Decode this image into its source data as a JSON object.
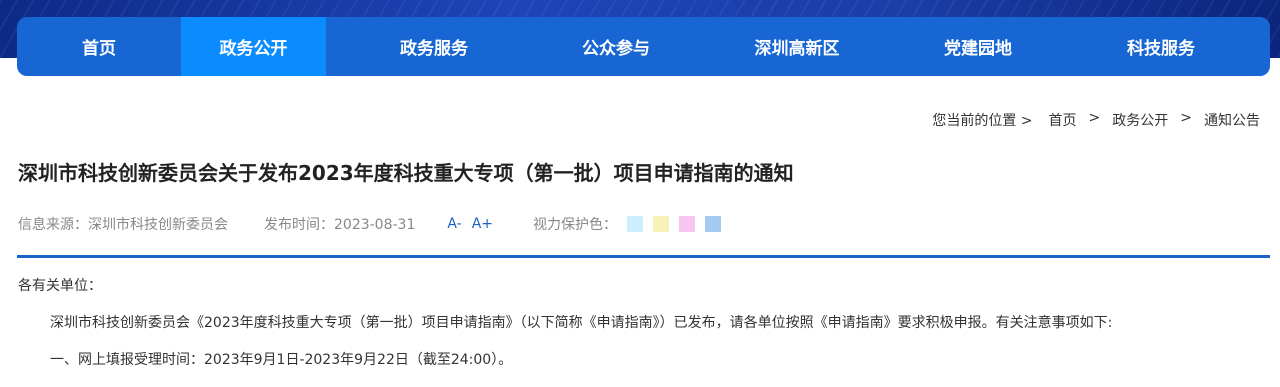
{
  "nav": {
    "items": [
      {
        "label": "首页"
      },
      {
        "label": "政务公开"
      },
      {
        "label": "政务服务"
      },
      {
        "label": "公众参与"
      },
      {
        "label": "深圳高新区"
      },
      {
        "label": "党建园地"
      },
      {
        "label": "科技服务"
      }
    ],
    "active_index": 1
  },
  "breadcrumb": {
    "prefix": "您当前的位置 >",
    "items": [
      "首页",
      "政务公开",
      "通知公告"
    ],
    "separator": ">"
  },
  "article": {
    "title": "深圳市科技创新委员会关于发布2023年度科技重大专项（第一批）项目申请指南的通知",
    "source": "信息来源：深圳市科技创新委员会",
    "publish_time": "发布时间：2023-08-31",
    "font_decrease": "A-",
    "font_increase": "A+",
    "eye_protect_label": "视力保护色：",
    "eye_colors": [
      "#cceeff",
      "#f7f0b8",
      "#f6c6f1",
      "#a6c9f2"
    ],
    "paragraphs": [
      "各有关单位：",
      "深圳市科技创新委员会《2023年度科技重大专项（第一批）项目申请指南》（以下简称《申请指南》）已发布，请各单位按照《申请指南》要求积极申报。有关注意事项如下:",
      "一、网上填报受理时间：2023年9月1日-2023年9月22日（截至24:00）。"
    ]
  },
  "colors": {
    "nav_bg": "#1766d3",
    "nav_active": "#0a8cff",
    "accent": "#1b62c7"
  }
}
